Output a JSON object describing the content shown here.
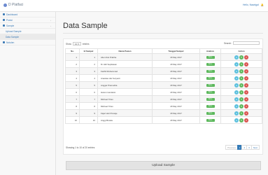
{
  "app": {
    "title": "D Platfaci"
  },
  "user": {
    "label": "Hello, Nawdgal",
    "bell": "🔔"
  },
  "sidebar": {
    "items": [
      {
        "label": "Dashboard",
        "chev": ""
      },
      {
        "label": "Posisi",
        "chev": "‹"
      },
      {
        "label": "Sample",
        "chev": "‹"
      },
      {
        "label": "Upload Sample",
        "chev": ""
      },
      {
        "label": "Data Sample",
        "chev": ""
      },
      {
        "label": "Notulen",
        "chev": ""
      }
    ]
  },
  "page": {
    "title": "Data Sample"
  },
  "controls": {
    "show": "Show",
    "entries_value": "10",
    "entries": "entries",
    "search": "Search:"
  },
  "table": {
    "headers": [
      "No.",
      "Id Sampel",
      "Nama Pasien",
      "Tanggal Sampel",
      "Analisis",
      "Action"
    ],
    "rows": [
      {
        "no": "1",
        "id": "1",
        "name": "Alien Dwi Prabha",
        "date": "18 May 2017",
        "status": "Done"
      },
      {
        "no": "2",
        "id": "2",
        "name": "M. Aldi Septiawan",
        "date": "18 May 2017",
        "status": "Done"
      },
      {
        "no": "3",
        "id": "3",
        "name": "Fadhil Muhammad",
        "date": "18 May 2017",
        "status": "Done"
      },
      {
        "no": "4",
        "id": "4",
        "name": "Anastias dwi Suryanti",
        "date": "18 May 2017",
        "status": "Done"
      },
      {
        "no": "5",
        "id": "5",
        "name": "Anggar Pramudita",
        "date": "18 May 2017",
        "status": "Done"
      },
      {
        "no": "6",
        "id": "6",
        "name": "Harum Hendarsi",
        "date": "18 May 2017",
        "status": "Done"
      },
      {
        "no": "7",
        "id": "7",
        "name": "Michael Tritex",
        "date": "18 May 2017",
        "status": "Done"
      },
      {
        "no": "8",
        "id": "8",
        "name": "Michael Tritex",
        "date": "18 May 2017",
        "status": "Done"
      },
      {
        "no": "9",
        "id": "9",
        "name": "Fajar Hari Pranaje",
        "date": "18 May 2017",
        "status": "Done"
      },
      {
        "no": "10",
        "id": "10",
        "name": "Anggi Bowka",
        "date": "18 May 2017",
        "status": "Done"
      }
    ]
  },
  "footer": {
    "info": "Showing 1 to 10 of 20 entries"
  },
  "pager": {
    "prev": "Previous",
    "p1": "1",
    "p2": "2",
    "p3": "3",
    "next": "Next"
  },
  "upload": {
    "label": "Upload Sample"
  },
  "icons": {
    "view": "eye-icon",
    "edit": "pencil-icon",
    "delete": "trash-icon"
  },
  "colors": {
    "primary": "#337ab7",
    "success": "#5cb85c",
    "info": "#5bc0de",
    "danger": "#d9534f"
  }
}
